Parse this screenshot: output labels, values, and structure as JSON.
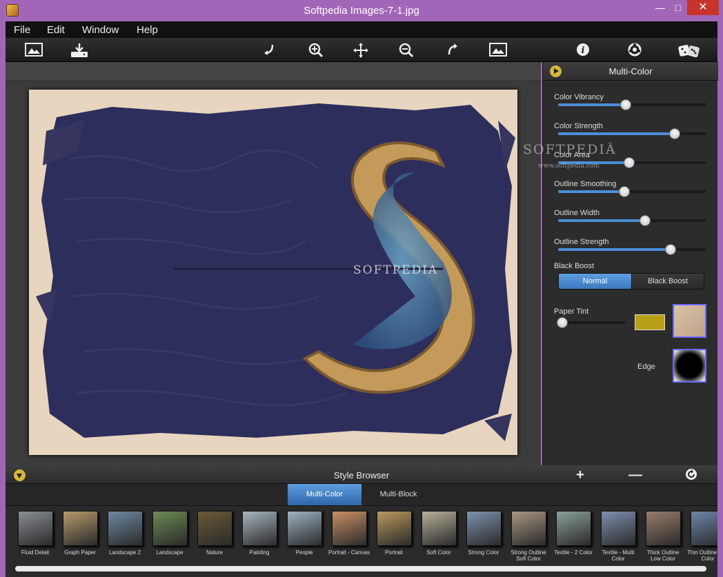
{
  "window": {
    "title": "Softpedia Images-7-1.jpg",
    "min_icon": "minimize-icon",
    "max_icon": "maximize-icon",
    "close_icon": "close-icon"
  },
  "menu": [
    "File",
    "Edit",
    "Window",
    "Help"
  ],
  "toolbar": {
    "icons": [
      "open-image-icon",
      "save-icon",
      "rotate-left-icon",
      "zoom-in-icon",
      "pan-icon",
      "zoom-out-icon",
      "rotate-right-icon",
      "fit-image-icon",
      "info-icon",
      "settings-icon",
      "randomize-dice-icon"
    ]
  },
  "canvas": {
    "watermark_main": "SOFTPEDIA",
    "watermark_center": "SOFTPEDIA",
    "watermark_url": "www.softpedia.com",
    "watermark_tm": "™"
  },
  "panel": {
    "title": "Multi-Color",
    "sliders": [
      {
        "label": "Color Vibrancy",
        "value": 0.46
      },
      {
        "label": "Color Strength",
        "value": 0.79
      },
      {
        "label": "Color Area",
        "value": 0.48
      },
      {
        "label": "Outline Smoothing",
        "value": 0.45
      },
      {
        "label": "Outline Width",
        "value": 0.59
      },
      {
        "label": "Outline Strength",
        "value": 0.76
      }
    ],
    "black_boost_label": "Black Boost",
    "black_boost_options": [
      "Normal",
      "Black Boost"
    ],
    "black_boost_selected": "Normal",
    "paper_tint_label": "Paper Tint",
    "paper_tint_value": 0.02,
    "paper_tint_color": "#b8a016",
    "edge_label": "Edge"
  },
  "browser": {
    "title": "Style Browser",
    "add_icon": "plus-icon",
    "remove_icon": "minus-icon",
    "reset_icon": "reset-icon",
    "tabs": [
      "Multi-Color",
      "Multi-Block"
    ],
    "active_tab": "Multi-Color",
    "styles": [
      {
        "label": "Fluid Detail",
        "color": "#8a8f95"
      },
      {
        "label": "Graph Paper",
        "color": "#b69a6c"
      },
      {
        "label": "Landscape 2",
        "color": "#6d8aa3"
      },
      {
        "label": "Landscape",
        "color": "#6e8c54"
      },
      {
        "label": "Nature",
        "color": "#6a5a36"
      },
      {
        "label": "Painting",
        "color": "#a8b6c0"
      },
      {
        "label": "People",
        "color": "#9fb3c3"
      },
      {
        "label": "Portrait - Canvas",
        "color": "#c99066"
      },
      {
        "label": "Portrait",
        "color": "#b99a5e"
      },
      {
        "label": "Soft Color",
        "color": "#b7b09a"
      },
      {
        "label": "Strong Color",
        "color": "#7d93ae"
      },
      {
        "label": "Strong Outline Soft Color",
        "color": "#a89780"
      },
      {
        "label": "Textile - 2 Color",
        "color": "#8ca09a"
      },
      {
        "label": "Textile - Multi Color",
        "color": "#7f8fb0"
      },
      {
        "label": "Thick Outline Low Color",
        "color": "#9a7d6c"
      },
      {
        "label": "Thin Outline Low Color",
        "color": "#6e86a8"
      }
    ]
  }
}
